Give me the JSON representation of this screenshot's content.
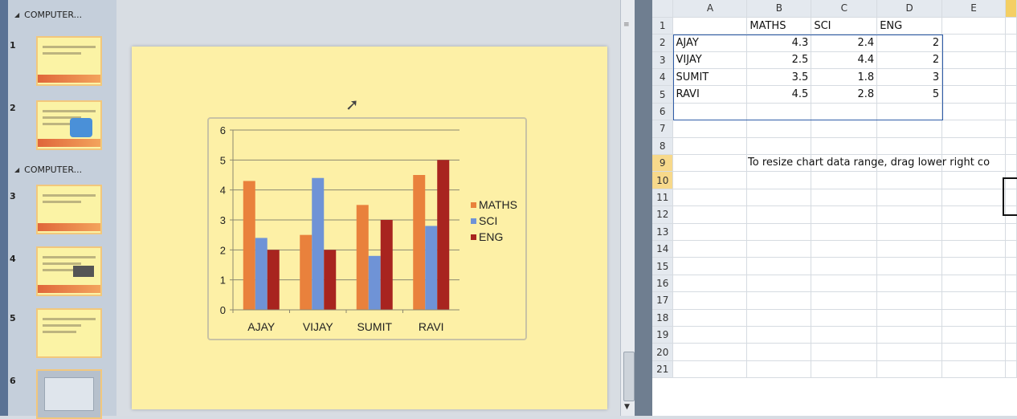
{
  "thumbnails": {
    "sections": [
      {
        "label": "COMPUTER..."
      },
      {
        "label": "COMPUTER..."
      }
    ],
    "slides": [
      {
        "number": "1"
      },
      {
        "number": "2"
      },
      {
        "number": "3"
      },
      {
        "number": "4"
      },
      {
        "number": "5"
      },
      {
        "number": "6"
      }
    ]
  },
  "chart_data": {
    "type": "bar",
    "categories": [
      "AJAY",
      "VIJAY",
      "SUMIT",
      "RAVI"
    ],
    "series": [
      {
        "name": "MATHS",
        "values": [
          4.3,
          2.5,
          3.5,
          4.5
        ],
        "color": "#e9813c"
      },
      {
        "name": "SCI",
        "values": [
          2.4,
          4.4,
          1.8,
          2.8
        ],
        "color": "#6f93d6"
      },
      {
        "name": "ENG",
        "values": [
          2,
          2,
          3,
          5
        ],
        "color": "#a8241f"
      }
    ],
    "ylim": [
      0,
      6
    ],
    "yticks": [
      "0",
      "1",
      "2",
      "3",
      "4",
      "5",
      "6"
    ],
    "grid": true,
    "legend": "right"
  },
  "sheet": {
    "columns": [
      "A",
      "B",
      "C",
      "D",
      "E"
    ],
    "rows": [
      {
        "n": "1",
        "a": "",
        "b": "MATHS",
        "c": "SCI",
        "d": "ENG"
      },
      {
        "n": "2",
        "a": "AJAY",
        "b": "4.3",
        "c": "2.4",
        "d": "2"
      },
      {
        "n": "3",
        "a": "VIJAY",
        "b": "2.5",
        "c": "4.4",
        "d": "2"
      },
      {
        "n": "4",
        "a": "SUMIT",
        "b": "3.5",
        "c": "1.8",
        "d": "3"
      },
      {
        "n": "5",
        "a": "RAVI",
        "b": "4.5",
        "c": "2.8",
        "d": "5"
      },
      {
        "n": "6"
      },
      {
        "n": "7"
      },
      {
        "n": "8"
      },
      {
        "n": "9"
      },
      {
        "n": "10"
      },
      {
        "n": "11"
      },
      {
        "n": "12"
      },
      {
        "n": "13"
      },
      {
        "n": "14"
      },
      {
        "n": "15"
      },
      {
        "n": "16"
      },
      {
        "n": "17"
      },
      {
        "n": "18"
      },
      {
        "n": "19"
      },
      {
        "n": "20"
      },
      {
        "n": "21"
      }
    ],
    "note": "To resize chart data range, drag lower right co",
    "selected_rows": [
      "9",
      "10"
    ]
  }
}
